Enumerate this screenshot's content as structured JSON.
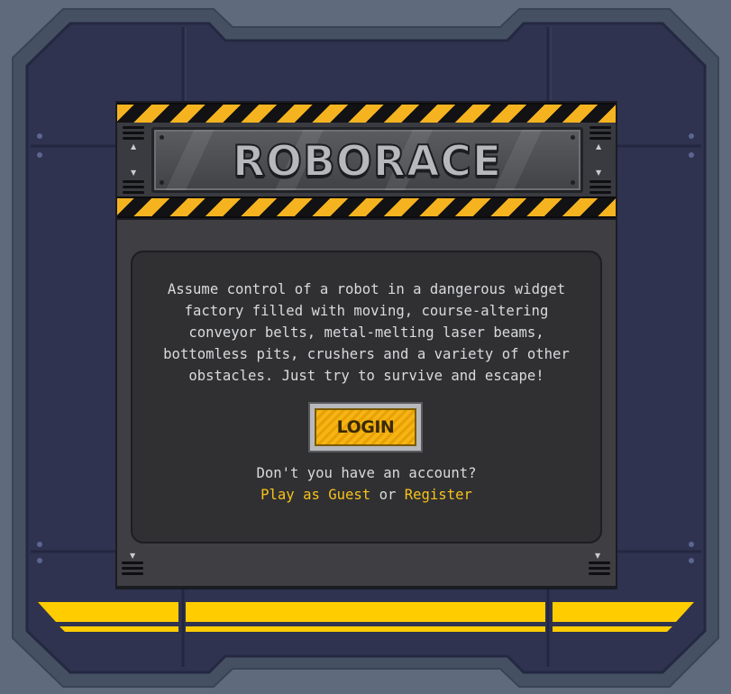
{
  "game": {
    "title": "ROBORACE",
    "description": "Assume control of a robot in a dangerous widget factory filled with moving, course-altering conveyor belts, metal-melting laser beams, bottomless pits, crushers and a variety of other obstacles. Just try to survive and escape!",
    "login_label": "LOGIN",
    "account_question": "Don't you have an account?",
    "guest_link": "Play as Guest",
    "or_text": "or",
    "register_link": "Register"
  },
  "colors": {
    "background": "#5f6b7d",
    "frame": "#2f3350",
    "hazard_yellow": "#f6b320",
    "accent_yellow": "#ffcc00",
    "link": "#f7c21a"
  },
  "icons": {
    "arrow_up": "▲",
    "arrow_down": "▼"
  }
}
